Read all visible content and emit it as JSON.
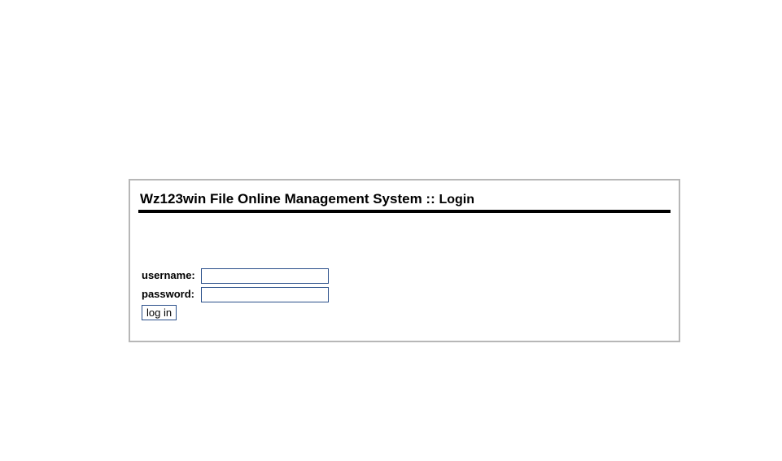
{
  "login": {
    "title_main": "Wz123win File Online Management System ::",
    "title_sub": "Login",
    "username_label": "username:",
    "username_value": "",
    "password_label": "password:",
    "password_value": "",
    "button_label": "log in"
  },
  "colors": {
    "box_border": "#b7b7b7",
    "title_rule": "#000000",
    "field_border": "#2a4f8a"
  }
}
